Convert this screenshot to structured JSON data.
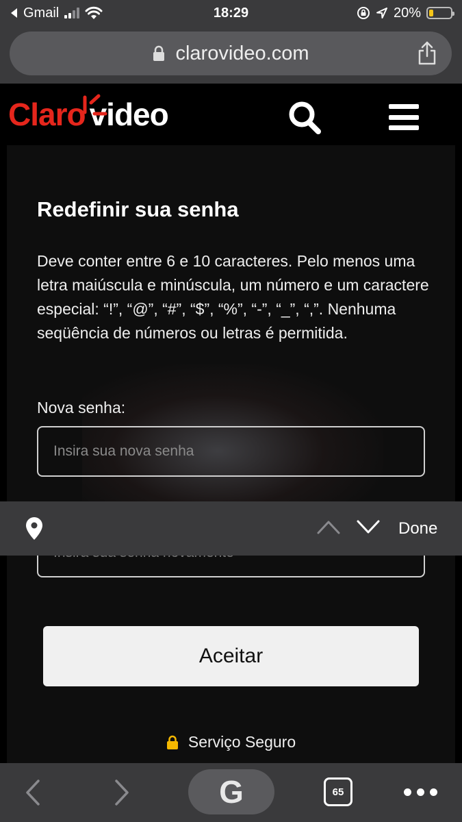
{
  "status_bar": {
    "carrier": "Gmail",
    "time": "18:29",
    "battery_percent": "20%",
    "battery_level": 0.2,
    "battery_color": "#f5c518"
  },
  "browser": {
    "url": "clarovideo.com",
    "icons": [
      "lock-icon",
      "share-icon"
    ]
  },
  "site": {
    "logo_claro": "Claro",
    "logo_video": "video",
    "brand_color": "#e5261c",
    "icons": [
      "search-icon",
      "menu-icon"
    ]
  },
  "form": {
    "title": "Redefinir sua senha",
    "description": "Deve conter entre 6 e 10 caracteres. Pelo menos uma letra maiúscula e minúscula, um número e um caractere especial: “!”, “@”, “#”, “$”, “%”, “-”, “_”, “,”. Nenhuma seqüência de números ou letras é permitida.",
    "new_password_label": "Nova senha:",
    "new_password_placeholder": "Insira sua nova senha",
    "confirm_password_placeholder": "Insira sua senha novamente",
    "accept_button": "Aceitar",
    "secure_text": "Serviço Seguro",
    "secure_icon_color": "#f5b800"
  },
  "keyboard_accessory": {
    "done_label": "Done",
    "icons": [
      "location-pin-icon",
      "chevron-up-icon",
      "chevron-down-icon"
    ]
  },
  "toolbar": {
    "google_label": "G",
    "tab_count": "65",
    "icons": [
      "back-icon",
      "forward-icon",
      "google-icon",
      "tabs-icon",
      "more-icon"
    ]
  }
}
